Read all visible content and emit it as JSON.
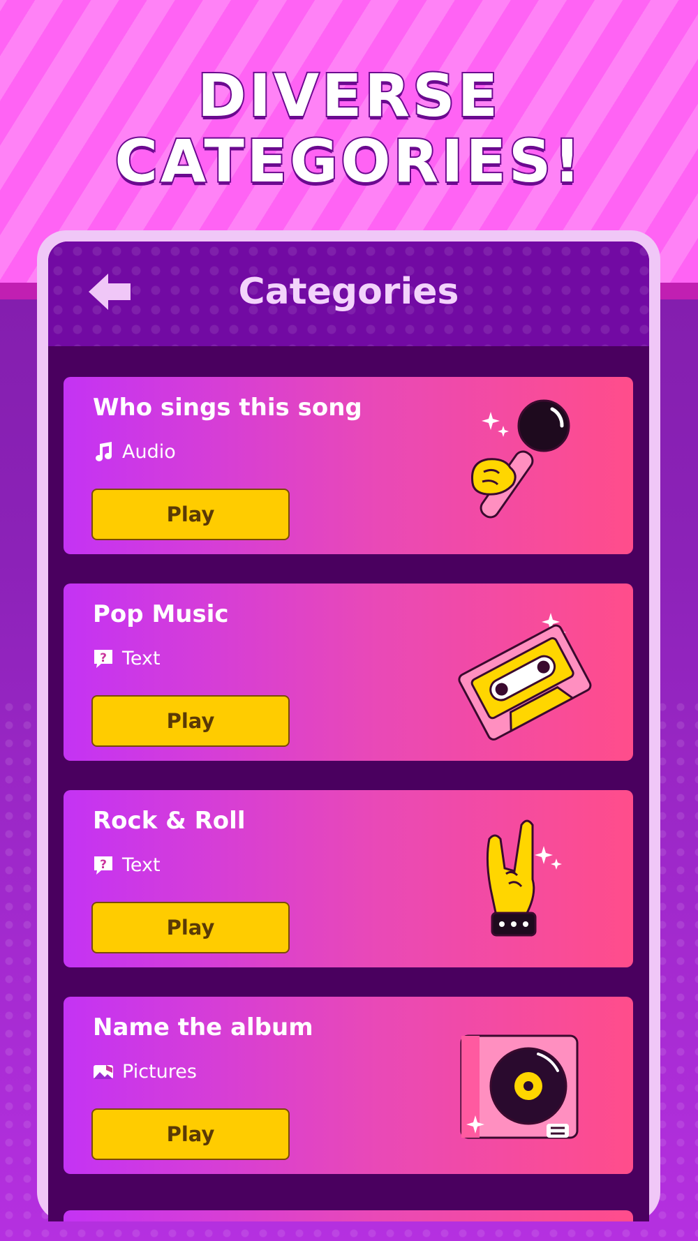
{
  "headline": {
    "line1": "DIVERSE",
    "line2": "CATEGORIES!"
  },
  "header": {
    "title": "Categories",
    "back_icon": "arrow-left-icon"
  },
  "colors": {
    "header": "#720aa3",
    "list_bg": "#4a005f",
    "card_start": "#c433f4",
    "card_end": "#ff4d8b",
    "play_button": "#ffcc00"
  },
  "categories": [
    {
      "title": "Who sings this song",
      "type": "Audio",
      "type_icon": "music-note-icon",
      "button": "Play",
      "art": "microphone-icon"
    },
    {
      "title": "Pop Music",
      "type": "Text",
      "type_icon": "question-bubble-icon",
      "button": "Play",
      "art": "cassette-tape-icon"
    },
    {
      "title": "Rock & Roll",
      "type": "Text",
      "type_icon": "question-bubble-icon",
      "button": "Play",
      "art": "rock-hand-icon"
    },
    {
      "title": "Name the album",
      "type": "Pictures",
      "type_icon": "picture-icon",
      "button": "Play",
      "art": "vinyl-record-icon"
    }
  ]
}
